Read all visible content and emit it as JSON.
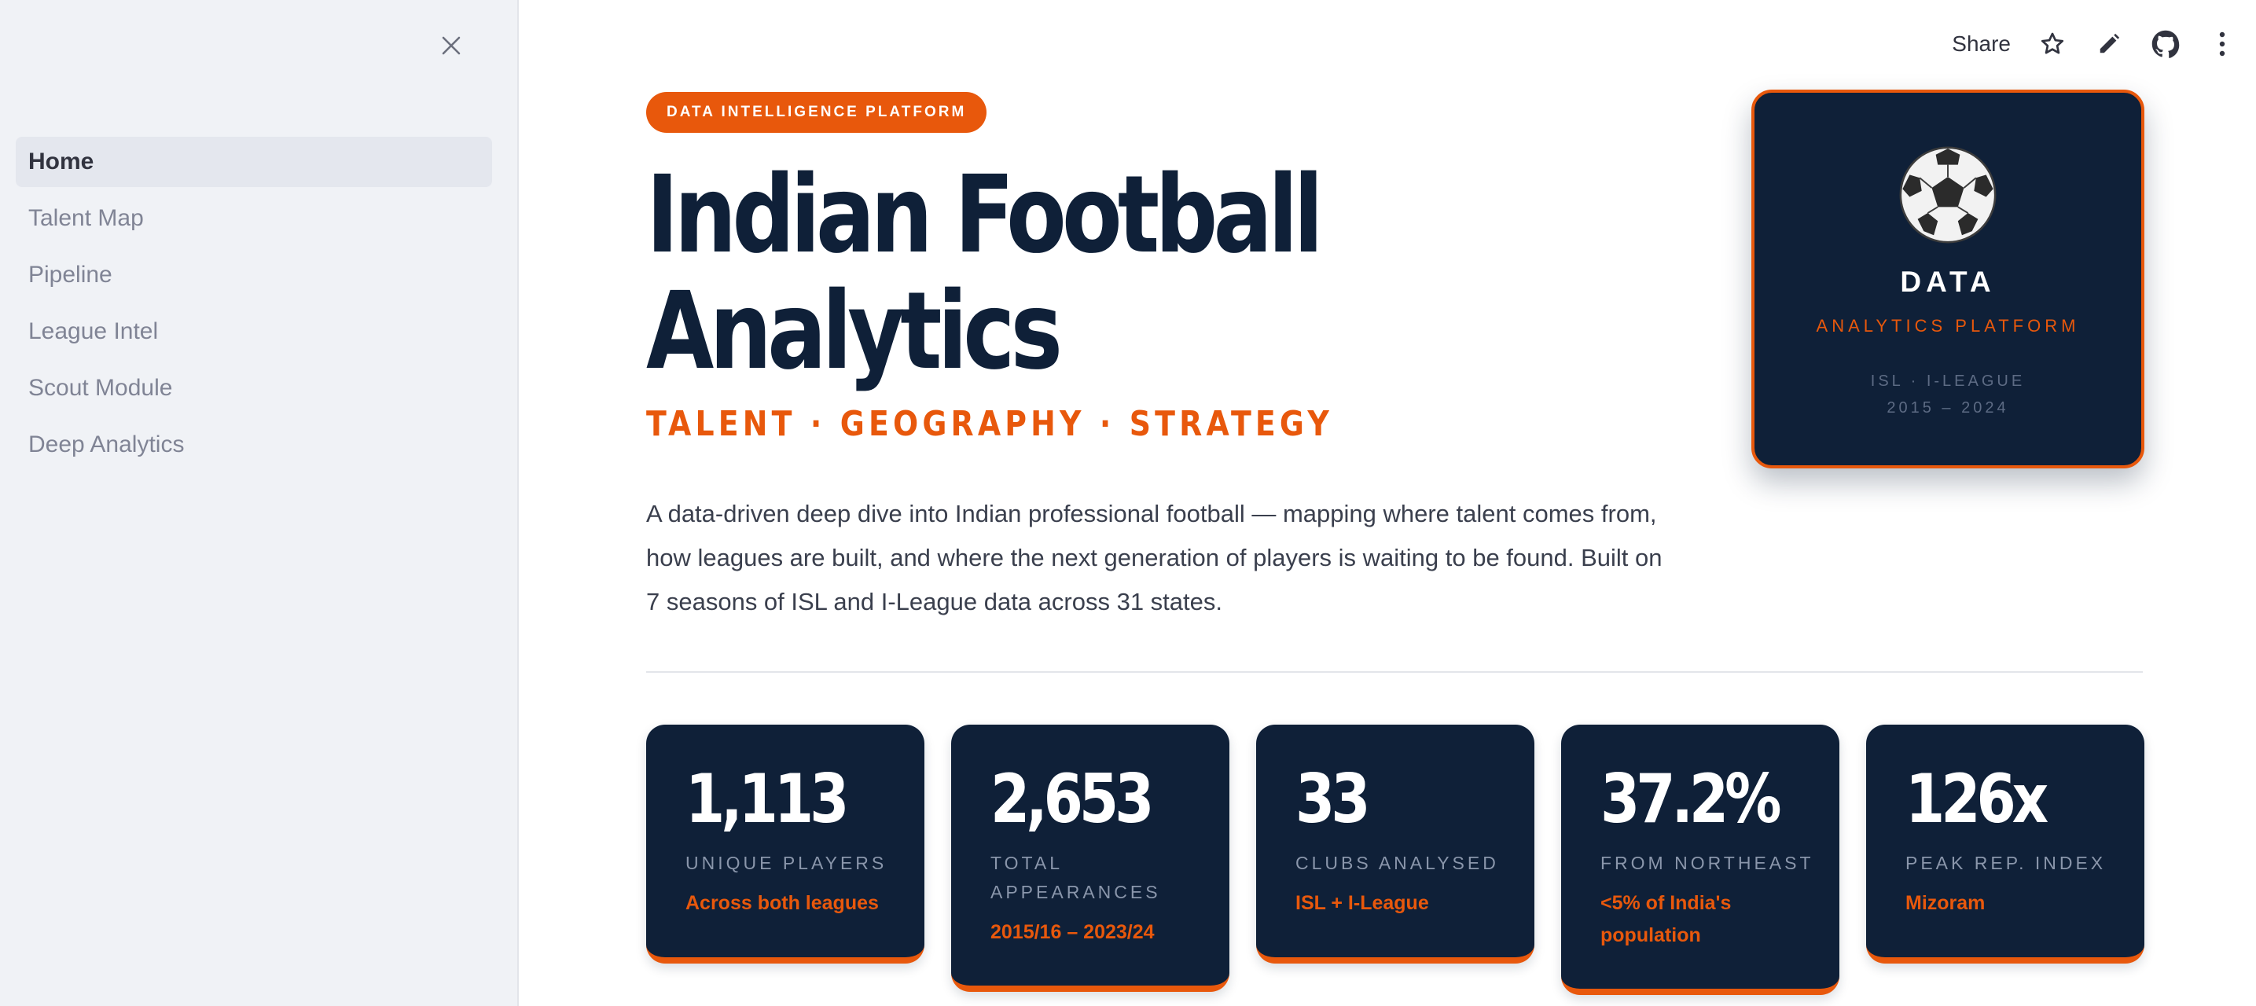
{
  "sidebar": {
    "items": [
      {
        "label": "Home"
      },
      {
        "label": "Talent Map"
      },
      {
        "label": "Pipeline"
      },
      {
        "label": "League Intel"
      },
      {
        "label": "Scout Module"
      },
      {
        "label": "Deep Analytics"
      }
    ],
    "active_index": 0
  },
  "toolbar": {
    "share_label": "Share",
    "icons": [
      "star-icon",
      "edit-icon",
      "github-icon",
      "more-vertical-icon"
    ]
  },
  "hero": {
    "pill": "DATA INTELLIGENCE PLATFORM",
    "title_line1": "Indian Football",
    "title_line2": "Analytics",
    "tagline": "TALENT · GEOGRAPHY · STRATEGY",
    "description": "A data-driven deep dive into Indian professional football — mapping where talent comes from, how leagues are built, and where the next generation of players is waiting to be found. Built on 7 seasons of ISL and I-League data across 31 states."
  },
  "hero_card": {
    "icon": "soccer-ball-icon",
    "label": "DATA",
    "subtitle": "ANALYTICS PLATFORM",
    "meta_line1": "ISL · I-LEAGUE",
    "meta_line2": "2015 – 2024"
  },
  "stats": [
    {
      "value": "1,113",
      "label": "UNIQUE PLAYERS",
      "note": "Across both leagues"
    },
    {
      "value": "2,653",
      "label": "TOTAL APPEARANCES",
      "note": "2015/16 – 2023/24"
    },
    {
      "value": "33",
      "label": "CLUBS ANALYSED",
      "note": "ISL + I-League"
    },
    {
      "value": "37.2%",
      "label": "FROM NORTHEAST",
      "note": "<5% of India's population"
    },
    {
      "value": "126x",
      "label": "PEAK REP. INDEX",
      "note": "Mizoram"
    }
  ],
  "colors": {
    "accent": "#e8580c",
    "navy": "#0f2038",
    "sidebar_bg": "#f0f2f6"
  }
}
